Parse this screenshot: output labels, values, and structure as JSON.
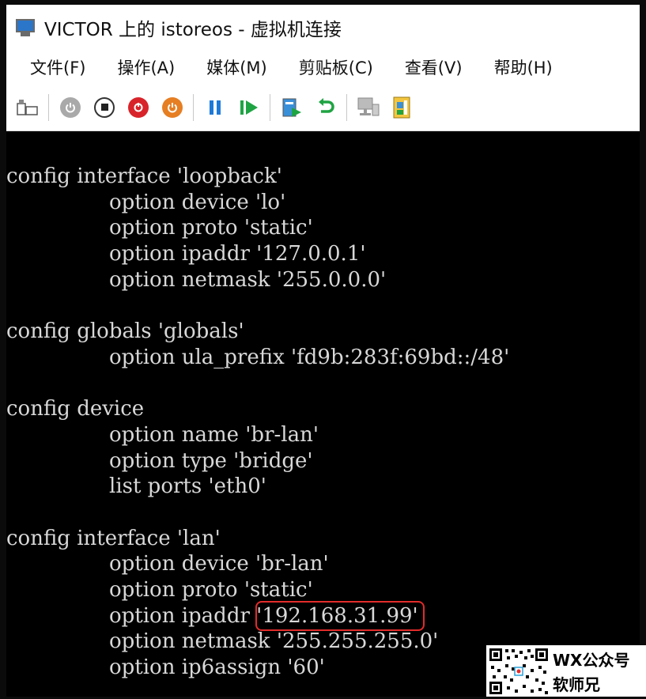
{
  "window": {
    "title": "VICTOR 上的 istoreos - 虚拟机连接"
  },
  "menu": [
    "文件(F)",
    "操作(A)",
    "媒体(M)",
    "剪贴板(C)",
    "查看(V)",
    "帮助(H)"
  ],
  "toolbar": [
    "ctrl-alt-del-icon",
    "start-icon",
    "turn-off-icon",
    "shut-down-icon",
    "save-state-icon",
    "pause-icon",
    "resume-icon",
    "checkpoint-icon",
    "revert-icon",
    "enhanced-session-icon",
    "zoom-icon"
  ],
  "console": {
    "lines": [
      {
        "text": "config interface 'loopback'",
        "indent": false
      },
      {
        "text": "option device 'lo'",
        "indent": true
      },
      {
        "text": "option proto 'static'",
        "indent": true
      },
      {
        "text": "option ipaddr '127.0.0.1'",
        "indent": true
      },
      {
        "text": "option netmask '255.0.0.0'",
        "indent": true
      },
      {
        "text": "",
        "indent": false
      },
      {
        "text": "config globals 'globals'",
        "indent": false
      },
      {
        "text": "option ula_prefix 'fd9b:283f:69bd::/48'",
        "indent": true
      },
      {
        "text": "",
        "indent": false
      },
      {
        "text": "config device",
        "indent": false
      },
      {
        "text": "option name 'br-lan'",
        "indent": true
      },
      {
        "text": "option type 'bridge'",
        "indent": true
      },
      {
        "text": "list ports 'eth0'",
        "indent": true
      },
      {
        "text": "",
        "indent": false
      },
      {
        "text": "config interface 'lan'",
        "indent": false
      },
      {
        "text": "option device 'br-lan'",
        "indent": true
      },
      {
        "text": "option proto 'static'",
        "indent": true
      },
      {
        "text": "option ipaddr '",
        "indent": true,
        "highlight": "192.168.31.99'"
      },
      {
        "text": "option netmask '255.255.255.0'",
        "indent": true
      },
      {
        "text": "option ip6assign '60'",
        "indent": true
      }
    ]
  },
  "watermark": {
    "line1": "WX公众号",
    "line2": "软师兄"
  },
  "colors": {
    "highlight_border": "#e32b2b",
    "console_bg": "#000000",
    "console_text": "#d8d8d8"
  }
}
